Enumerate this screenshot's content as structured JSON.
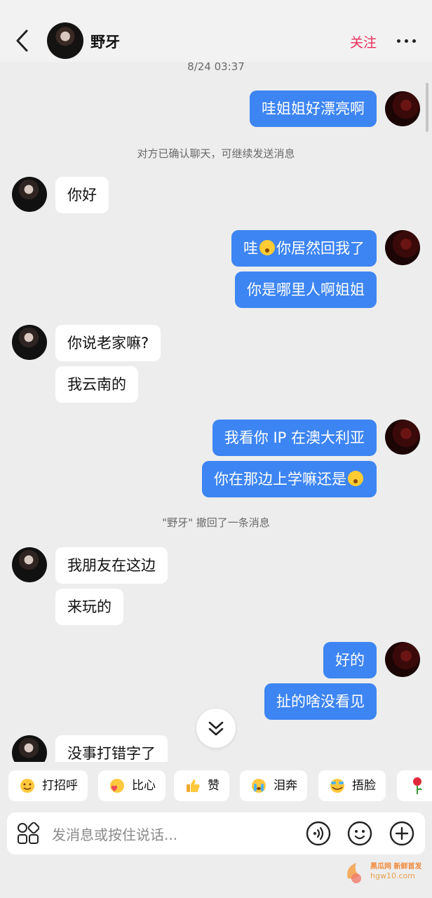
{
  "header": {
    "name": "野牙",
    "follow_label": "关注"
  },
  "chat": {
    "timestamp": "8/24 03:37",
    "system_confirm": "对方已确认聊天，可继续发送消息",
    "system_recall": "\"野牙\" 撤回了一条消息",
    "messages": {
      "m1": "哇姐姐好漂亮啊",
      "m2": "你好",
      "m3a": "哇",
      "m3b": "你居然回我了",
      "m4": "你是哪里人啊姐姐",
      "m5": "你说老家嘛?",
      "m6": "我云南的",
      "m7": "我看你 IP 在澳大利亚",
      "m8": "你在那边上学嘛还是",
      "m9": "我朋友在这边",
      "m10": "来玩的",
      "m11": "好的",
      "m12": "扯的啥没看见",
      "m13": "没事打错字了"
    }
  },
  "quick_replies": {
    "greet": "打招呼",
    "heart": "比心",
    "like": "赞",
    "tears": "泪奔",
    "facepalm": "捂脸"
  },
  "input": {
    "placeholder": "发消息或按住说话..."
  },
  "watermark": {
    "line1": "黑瓜网 新鲜首发",
    "line2": "hgw10.com"
  },
  "colors": {
    "accent_follow": "#ec2b5a",
    "outgoing_bubble": "#3d85f2",
    "background": "#ededed"
  }
}
